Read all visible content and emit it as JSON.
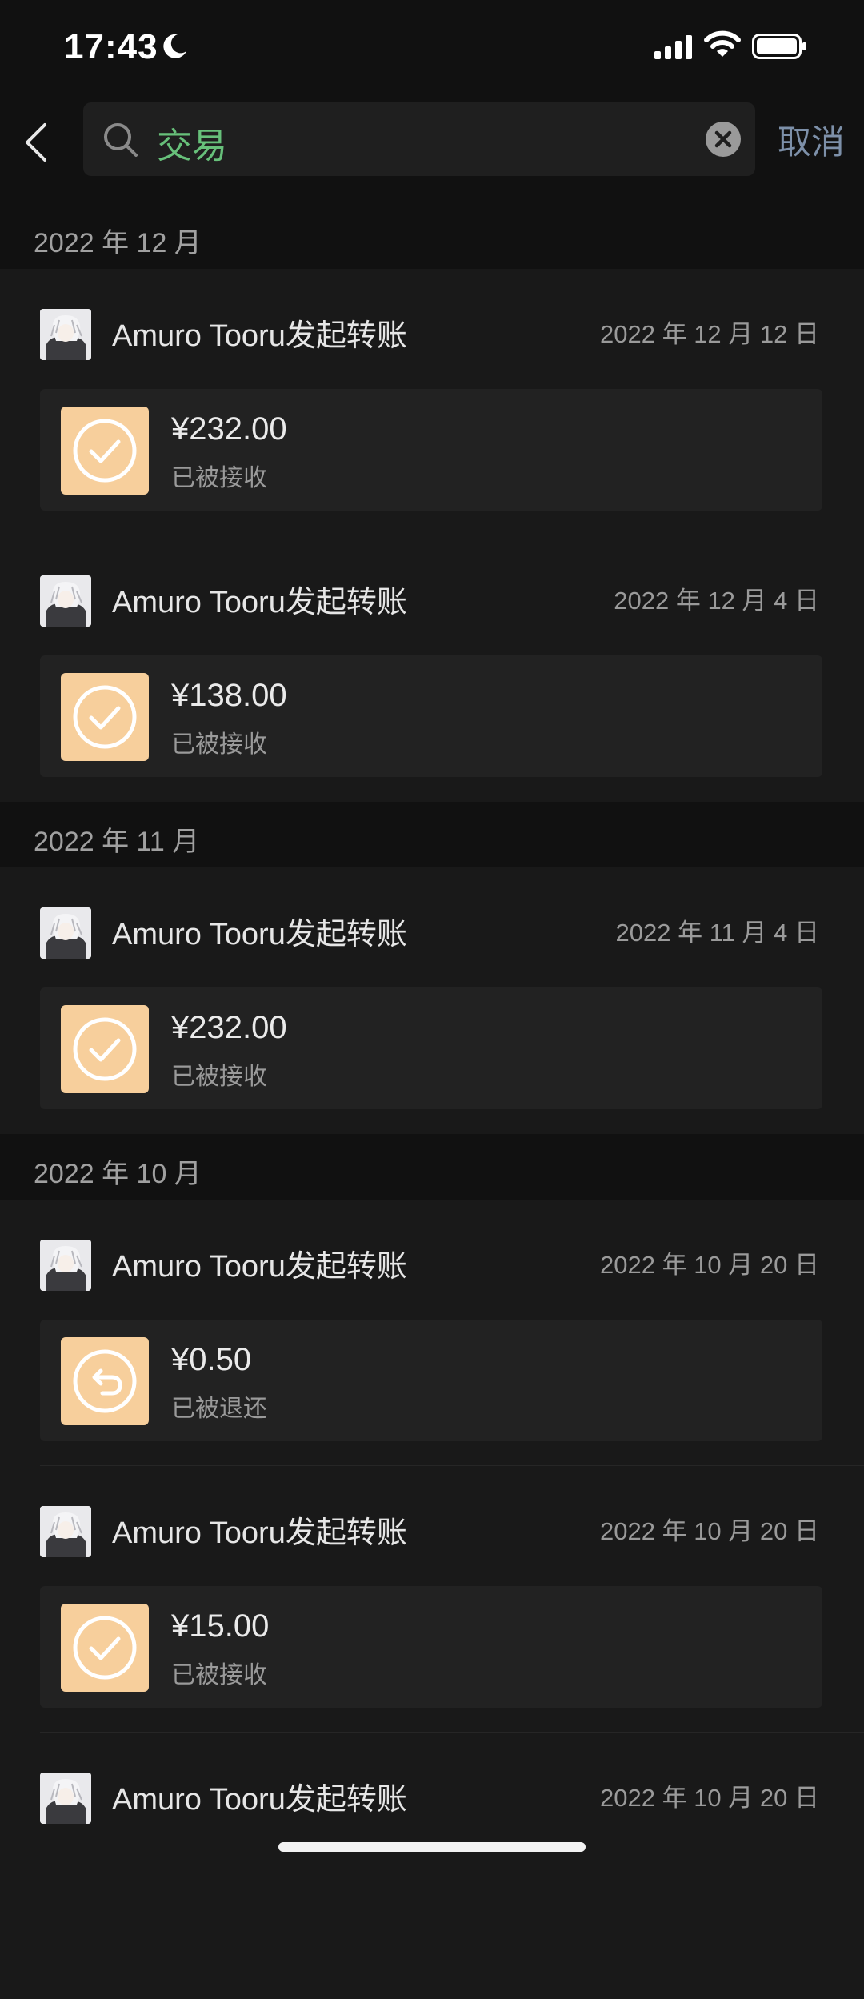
{
  "status_bar": {
    "time": "17:43"
  },
  "search": {
    "query": "交易",
    "cancel_label": "取消"
  },
  "list": {
    "months": [
      {
        "label": "2022 年 12 月",
        "items": [
          {
            "sender": "Amuro Tooru发起转账",
            "date": "2022 年 12 月 12 日",
            "amount": "¥232.00",
            "status": "已被接收",
            "icon": "check-circle-icon"
          },
          {
            "sender": "Amuro Tooru发起转账",
            "date": "2022 年 12 月 4 日",
            "amount": "¥138.00",
            "status": "已被接收",
            "icon": "check-circle-icon"
          }
        ]
      },
      {
        "label": "2022 年 11 月",
        "items": [
          {
            "sender": "Amuro Tooru发起转账",
            "date": "2022 年 11 月 4 日",
            "amount": "¥232.00",
            "status": "已被接收",
            "icon": "check-circle-icon"
          }
        ]
      },
      {
        "label": "2022 年 10 月",
        "items": [
          {
            "sender": "Amuro Tooru发起转账",
            "date": "2022 年 10 月 20 日",
            "amount": "¥0.50",
            "status": "已被退还",
            "icon": "return-circle-icon"
          },
          {
            "sender": "Amuro Tooru发起转账",
            "date": "2022 年 10 月 20 日",
            "amount": "¥15.00",
            "status": "已被接收",
            "icon": "check-circle-icon"
          },
          {
            "sender": "Amuro Tooru发起转账",
            "date": "2022 年 10 月 20 日"
          }
        ]
      }
    ]
  },
  "colors": {
    "accent_query": "#67c07a",
    "cancel": "#7d90a9",
    "transfer_icon_bg": "#f7cf9c"
  }
}
